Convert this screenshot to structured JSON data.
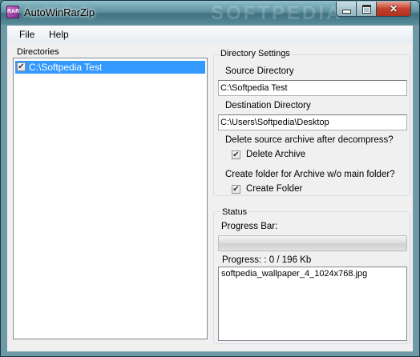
{
  "window": {
    "title": "AutoWinRarZip",
    "icon_text": "RAR",
    "watermark": "SOFTPEDIA"
  },
  "menu": {
    "items": [
      "File",
      "Help"
    ]
  },
  "directories": {
    "label": "Directories",
    "items": [
      {
        "path": "C:\\Softpedia Test",
        "checked": true,
        "selected": true
      }
    ]
  },
  "directory_settings": {
    "legend": "Directory Settings",
    "source_label": "Source Directory",
    "source_value": "C:\\Softpedia Test",
    "destination_label": "Destination Directory",
    "destination_value": "C:\\Users\\Softpedia\\Desktop",
    "delete_question": "Delete source archive after decompress?",
    "delete_label": "Delete Archive",
    "delete_checked": true,
    "folder_question": "Create folder for Archive w/o main folder?",
    "folder_label": "Create Folder",
    "folder_checked": true
  },
  "status": {
    "legend": "Status",
    "progress_label": "Progress Bar:",
    "progress_fraction": 0,
    "progress_text": "Progress: : 0 / 196 Kb",
    "files": [
      "softpedia_wallpaper_4_1024x768.jpg"
    ]
  },
  "colors": {
    "selection": "#3399ff",
    "close_button": "#c2412c"
  }
}
